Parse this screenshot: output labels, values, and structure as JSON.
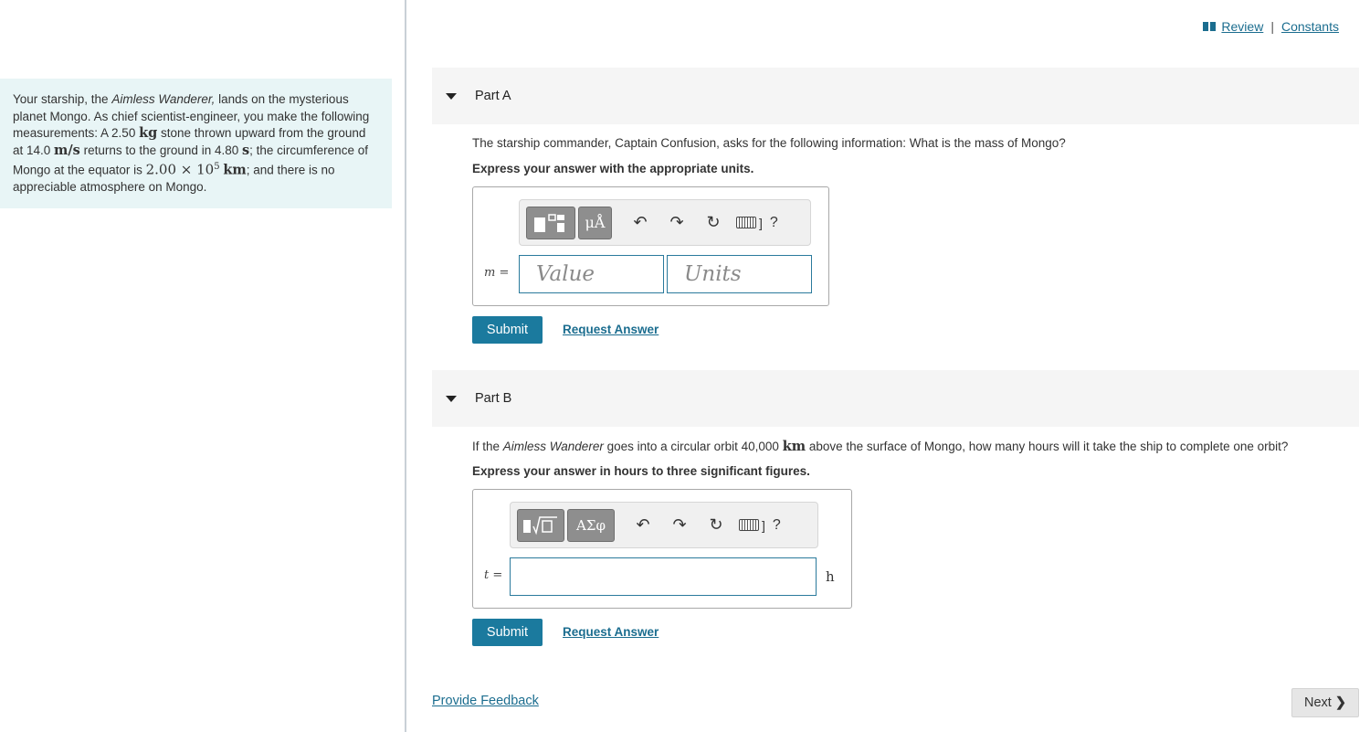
{
  "header": {
    "review_label": "Review",
    "separator": "|",
    "constants_label": "Constants"
  },
  "problem": {
    "t1": "Your starship, the ",
    "ship": "Aimless Wanderer,",
    "t2": " lands on the mysterious planet Mongo. As chief scientist-engineer, you make the following measurements: A 2.50 ",
    "u_kg": "kg",
    "t3": " stone thrown upward from the ground at 14.0 ",
    "u_ms": "m/s",
    "t4": " returns to the ground in 4.80 ",
    "u_s": "s",
    "t5": "; the circumference of Mongo at the equator is ",
    "circ": "2.00 × 10",
    "circ_exp": "5",
    "u_km": "km",
    "t6": "; and there is no appreciable atmosphere on Mongo."
  },
  "partA": {
    "title": "Part A",
    "question": "The starship commander, Captain Confusion, asks for the following information: What is the mass of Mongo?",
    "instruction": "Express your answer with the appropriate units.",
    "variable_label": "m =",
    "value_placeholder": "Value",
    "units_placeholder": "Units",
    "tool_units": "μÅ",
    "help": "?",
    "submit_label": "Submit",
    "request_label": "Request Answer"
  },
  "partB": {
    "title": "Part B",
    "q1": "If the ",
    "ship": "Aimless Wanderer",
    "q2": " goes into a circular orbit 40,000 ",
    "u_km": "km",
    "q3": " above the surface of Mongo, how many hours will it take the ship to complete one orbit?",
    "instruction": "Express your answer in hours to three significant figures.",
    "variable_label": "t =",
    "unit": "h",
    "tool_greek": "ΑΣφ",
    "help": "?",
    "submit_label": "Submit",
    "request_label": "Request Answer"
  },
  "footer": {
    "feedback_label": "Provide Feedback",
    "next_label": "Next"
  }
}
